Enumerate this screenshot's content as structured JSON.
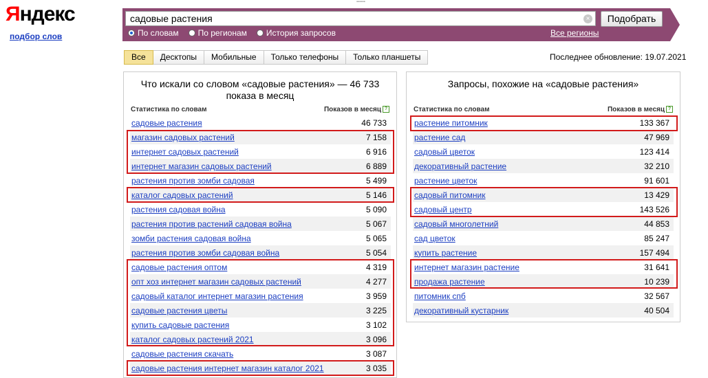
{
  "logo": {
    "first": "Я",
    "rest": "ндекс"
  },
  "subtitle": "подбор слов",
  "search": {
    "value": "садовые растения",
    "button": "Подобрать"
  },
  "radios": [
    {
      "label": "По словам",
      "selected": true
    },
    {
      "label": "По регионам",
      "selected": false
    },
    {
      "label": "История запросов",
      "selected": false
    }
  ],
  "all_regions": "Все регионы",
  "tabs": [
    "Все",
    "Десктопы",
    "Мобильные",
    "Только телефоны",
    "Только планшеты"
  ],
  "last_update": "Последнее обновление: 19.07.2021",
  "left": {
    "title": "Что искали со словом «садовые растения» — 46 733 показа в месяц",
    "col_query": "Статистика по словам",
    "col_count": "Показов в месяц",
    "rows": [
      {
        "q": "садовые растения",
        "n": "46 733"
      },
      {
        "q": "магазин садовых растений",
        "n": "7 158"
      },
      {
        "q": "интернет садовых растений",
        "n": "6 916"
      },
      {
        "q": "интернет магазин садовых растений",
        "n": "6 889"
      },
      {
        "q": "растения против зомби садовая",
        "n": "5 499"
      },
      {
        "q": "каталог садовых растений",
        "n": "5 146"
      },
      {
        "q": "растения садовая война",
        "n": "5 090"
      },
      {
        "q": "растения против растений садовая война",
        "n": "5 067"
      },
      {
        "q": "зомби растения садовая война",
        "n": "5 065"
      },
      {
        "q": "растения против зомби садовая война",
        "n": "5 054"
      },
      {
        "q": "садовые растения оптом",
        "n": "4 319"
      },
      {
        "q": "опт хоз интернет магазин садовых растений",
        "n": "4 277"
      },
      {
        "q": "садовый каталог интернет магазин растения",
        "n": "3 959"
      },
      {
        "q": "садовые растения цветы",
        "n": "3 225"
      },
      {
        "q": "купить садовые растения",
        "n": "3 102"
      },
      {
        "q": "каталог садовых растений 2021",
        "n": "3 096"
      },
      {
        "q": "садовые растения скачать",
        "n": "3 087"
      },
      {
        "q": "садовые растения интернет магазин каталог 2021",
        "n": "3 035"
      }
    ]
  },
  "right": {
    "title": "Запросы, похожие на «садовые растения»",
    "col_query": "Статистика по словам",
    "col_count": "Показов в месяц",
    "rows": [
      {
        "q": "растение питомник",
        "n": "133 367"
      },
      {
        "q": "растение сад",
        "n": "47 969"
      },
      {
        "q": "садовый цветок",
        "n": "123 414"
      },
      {
        "q": "декоративный растение",
        "n": "32 210"
      },
      {
        "q": "растение цветок",
        "n": "91 601"
      },
      {
        "q": "садовый питомник",
        "n": "13 429"
      },
      {
        "q": "садовый центр",
        "n": "143 526"
      },
      {
        "q": "садовый многолетний",
        "n": "44 853"
      },
      {
        "q": "сад цветок",
        "n": "85 247"
      },
      {
        "q": "купить растение",
        "n": "157 494"
      },
      {
        "q": "интернет магазин растение",
        "n": "31 641"
      },
      {
        "q": "продажа растение",
        "n": "10 239"
      },
      {
        "q": "питомник спб",
        "n": "32 567"
      },
      {
        "q": "декоративный кустарник",
        "n": "40 504"
      }
    ]
  }
}
